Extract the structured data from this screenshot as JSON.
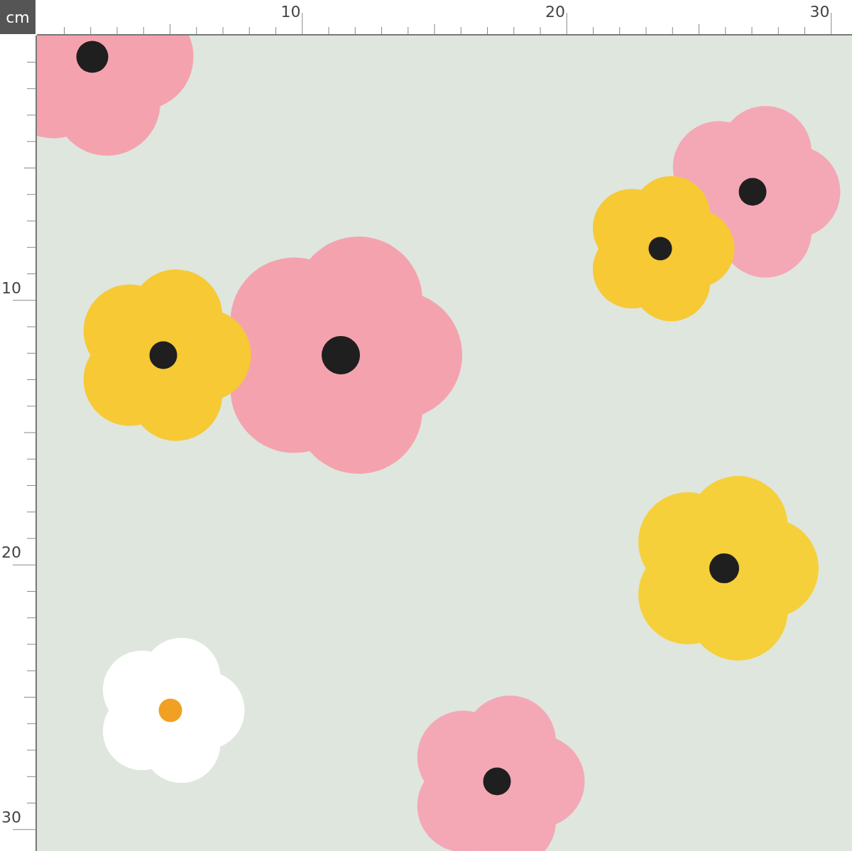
{
  "ruler": {
    "unit": "cm",
    "top_labels": [
      "10",
      "20",
      "30"
    ],
    "left_labels": [
      "10",
      "20",
      "30"
    ]
  },
  "fabric": {
    "kind": "floral-print"
  }
}
